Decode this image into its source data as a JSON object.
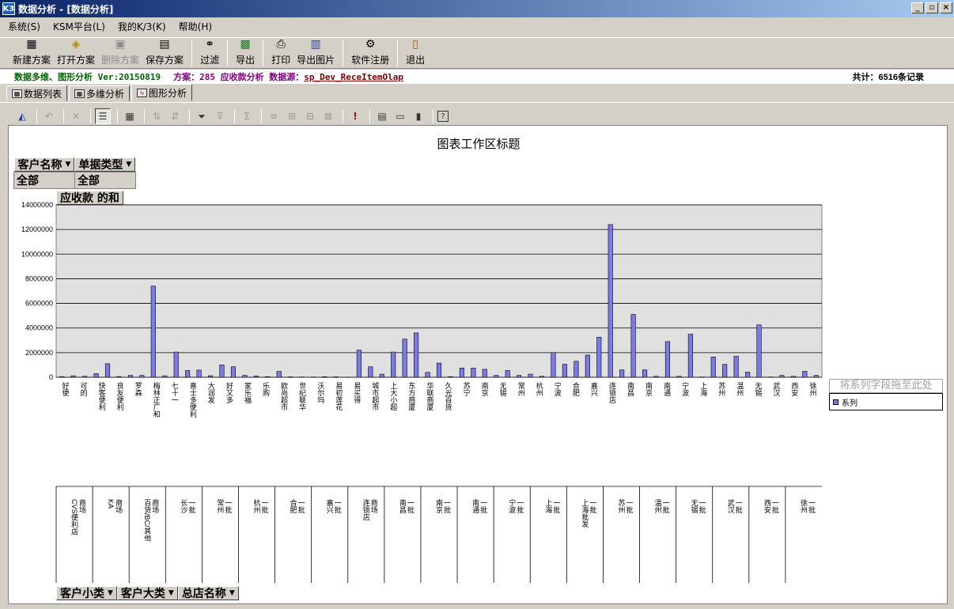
{
  "window": {
    "title": "数据分析 - [数据分析]",
    "app_icon_text": "K3"
  },
  "menu": {
    "items": [
      "系统(S)",
      "KSM平台(L)",
      "我的K/3(K)",
      "帮助(H)"
    ]
  },
  "toolbar": {
    "buttons": [
      {
        "label": "新建方案",
        "icon": "new-plan-icon",
        "enabled": true
      },
      {
        "label": "打开方案",
        "icon": "open-plan-icon",
        "enabled": true
      },
      {
        "label": "删除方案",
        "icon": "delete-plan-icon",
        "enabled": false
      },
      {
        "label": "保存方案",
        "icon": "save-plan-icon",
        "enabled": true
      },
      {
        "label": "过滤",
        "icon": "binoculars-icon",
        "enabled": true
      },
      {
        "label": "导出",
        "icon": "export-icon",
        "enabled": true
      },
      {
        "label": "打印",
        "icon": "printer-icon",
        "enabled": true
      },
      {
        "label": "导出图片",
        "icon": "export-image-icon",
        "enabled": true
      },
      {
        "label": "软件注册",
        "icon": "register-icon",
        "enabled": true
      },
      {
        "label": "退出",
        "icon": "exit-door-icon",
        "enabled": true
      }
    ]
  },
  "infobar": {
    "version_text": "数据多维、图形分析 Ver:20150819",
    "plan_text": "方案：285 应收款分析 数据源：",
    "source_text": "sp_Dev_ReceItemOlap",
    "total_text": "共计：6516条记录"
  },
  "tabs": [
    {
      "label": "数据列表",
      "active": false
    },
    {
      "label": "多维分析",
      "active": false
    },
    {
      "label": "图形分析",
      "active": true
    }
  ],
  "chart_toolbar": {
    "icons": [
      "chart-type-icon",
      "undo-icon",
      "delete-icon",
      "properties-icon",
      "grid-icon",
      "sort-ascending-icon",
      "sort-descending-icon",
      "filter-icon",
      "filter-clear-icon",
      "sum-icon",
      "field-list-icon",
      "group-icon",
      "ungroup-icon",
      "expand-icon",
      "alert-icon",
      "chart-wizard-icon",
      "page-icon",
      "book-icon",
      "help-icon"
    ]
  },
  "chart_area": {
    "title": "图表工作区标题",
    "filter_fields": [
      "客户名称",
      "单据类型"
    ],
    "filter_values": [
      "全部",
      "全部"
    ],
    "data_field": "应收款 的和",
    "row_fields": [
      "客户小类",
      "客户大类",
      "总店名称"
    ],
    "series_drop_hint": "将系列字段拖至此处",
    "legend_label": "系列"
  },
  "chart_data": {
    "type": "bar",
    "ylim": [
      0,
      14000000
    ],
    "yticks": [
      "0",
      "2000000",
      "4000000",
      "6000000",
      "8000000",
      "10000000",
      "12000000",
      "14000000"
    ],
    "series": [
      {
        "name": "系列",
        "color": "#7b7be8",
        "values": [
          60000,
          120000,
          80000,
          300000,
          1100000,
          60000,
          150000,
          150000,
          7400000,
          120000,
          2050000,
          550000,
          580000,
          120000,
          1000000,
          850000,
          150000,
          100000,
          50000,
          480000,
          30000,
          20000,
          20000,
          40000,
          30000,
          10000,
          2200000,
          850000,
          250000,
          2050000,
          3100000,
          3600000,
          400000,
          1150000,
          50000,
          750000,
          750000,
          650000,
          150000,
          550000,
          150000,
          250000,
          80000,
          2000000,
          1050000,
          1300000,
          1800000,
          3250000,
          12400000,
          600000,
          5100000,
          600000,
          80000,
          2900000,
          80000,
          3500000,
          20000,
          1650000,
          1050000,
          1700000,
          420000,
          4250000,
          20000,
          150000,
          80000,
          480000,
          150000
        ]
      }
    ],
    "category_labels": [
      "好便",
      "可的",
      "快客便利",
      "良友便利",
      "罗森",
      "梅林正广和",
      "七十一",
      "喜士多便利",
      "大润发",
      "好又多",
      "家乐福",
      "乐购",
      "欧尚超市",
      "世纪联华",
      "沃尔玛",
      "易初莲花",
      "易买得",
      "城市超市",
      "上大小超",
      "东方商厦",
      "华联商厦",
      "久光百货",
      "苏宁",
      "南京",
      "无锡",
      "常州",
      "杭州",
      "宁波",
      "合肥",
      "嘉兴",
      "连锁店",
      "南昌",
      "南京",
      "南通",
      "宁波",
      "上海",
      "苏州",
      "温州",
      "无锡",
      "武汉",
      "西安",
      "徐州"
    ],
    "group_labels": [
      "CVS便利店",
      "商场",
      "KA",
      "商场",
      "百货/BC/其他",
      "商场",
      "长沙",
      "一批",
      "常州",
      "一批",
      "杭州",
      "一批",
      "合肥",
      "一批",
      "嘉兴",
      "一批",
      "连锁店",
      "商场",
      "南昌",
      "一批",
      "南京",
      "一批",
      "南通",
      "一批",
      "宁波",
      "一批",
      "上海",
      "一批",
      "上海批发",
      "一批",
      "苏州",
      "一批",
      "温州",
      "一批",
      "无锡",
      "一批",
      "武汉",
      "一批",
      "西安",
      "一批",
      "徐州",
      "一批"
    ]
  }
}
